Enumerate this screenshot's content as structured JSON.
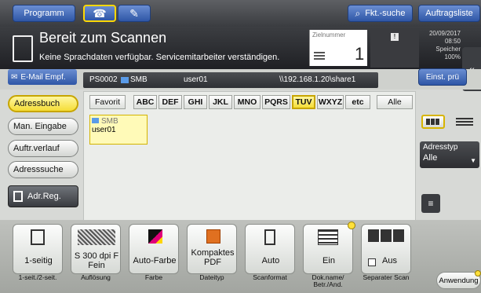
{
  "topbar": {
    "program_label": "Programm",
    "fkt_suche_label": "Fkt.-suche",
    "auftragsliste_label": "Auftragsliste"
  },
  "status": {
    "title": "Bereit zum Scannen",
    "message": "Keine Sprachdaten verfügbar. Servicemitarbeiter verständigen.",
    "zielnummer_label": "Zielnummer",
    "zielnummer_value": "1",
    "date": "20/09/2017",
    "time": "08:50",
    "speicher_label": "Speicher",
    "speicher_value": "100%"
  },
  "dest": {
    "email_label": "E-Mail Empf.",
    "id": "PS0002",
    "type": "SMB",
    "user": "user01",
    "path": "\\\\192.168.1.20\\share1",
    "einst_label": "Einst. prü"
  },
  "sidebar": {
    "items": [
      {
        "label": "Adressbuch"
      },
      {
        "label": "Man. Eingabe"
      },
      {
        "label": "Auftr.verlauf"
      },
      {
        "label": "Adresssuche"
      }
    ],
    "adr_reg_label": "Adr.Reg."
  },
  "filters": {
    "favorit": "Favorit",
    "letters": [
      "ABC",
      "DEF",
      "GHI",
      "JKL",
      "MNO",
      "PQRS",
      "TUV",
      "WXYZ",
      "etc"
    ],
    "alle": "Alle"
  },
  "address_card": {
    "type": "SMB",
    "name": "user01"
  },
  "adresstyp": {
    "label": "Adresstyp",
    "value": "Alle"
  },
  "functions": [
    {
      "label": "1-seitig",
      "caption": "1-seit./2-seit.",
      "icon": "duplex-icon"
    },
    {
      "label": "S 300 dpi F Fein",
      "caption": "Auflösung",
      "icon": "resolution-icon"
    },
    {
      "label": "Auto-Farbe",
      "caption": "Farbe",
      "icon": "color-icon"
    },
    {
      "label": "Kompaktes PDF",
      "caption": "Dateityp",
      "icon": "pdf-icon"
    },
    {
      "label": "Auto",
      "caption": "Scanformat",
      "icon": "scan-size-icon"
    },
    {
      "label": "Ein",
      "caption": "Dok.name/ Betr./And.",
      "icon": "docname-icon"
    },
    {
      "label": "Aus",
      "caption": "Separater Scan",
      "icon": "separate-scan-icon"
    }
  ],
  "anwendung_label": "Anwendung",
  "colors": {
    "accent_blue": "#2e56a6",
    "selected_yellow": "#f5dd37"
  }
}
